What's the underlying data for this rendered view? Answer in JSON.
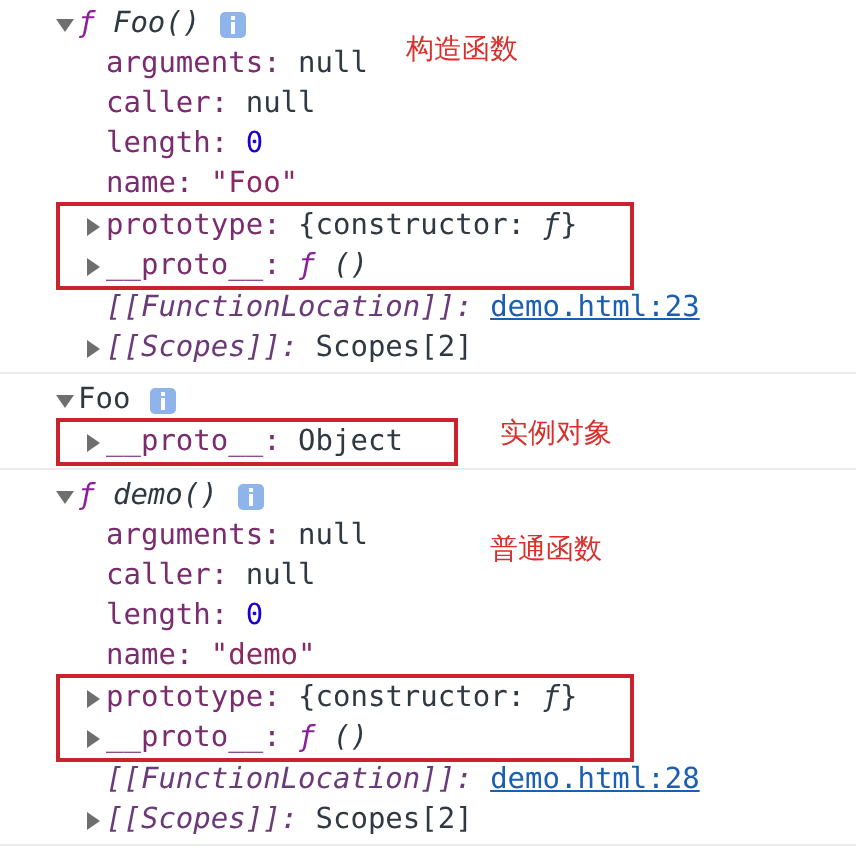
{
  "entries": [
    {
      "kind": "function",
      "prefix": "ƒ",
      "name": "Foo()",
      "expanded": true,
      "annotation": "构造函数",
      "properties": [
        {
          "key": "arguments:",
          "value": "null",
          "kind": "plain",
          "expandable": false,
          "internal": false,
          "highlighted": false
        },
        {
          "key": "caller:",
          "value": "null",
          "kind": "plain",
          "expandable": false,
          "internal": false,
          "highlighted": false
        },
        {
          "key": "length:",
          "value": "0",
          "kind": "number",
          "expandable": false,
          "internal": false,
          "highlighted": false
        },
        {
          "key": "name:",
          "value": "\"Foo\"",
          "kind": "string",
          "expandable": false,
          "internal": false,
          "highlighted": false
        },
        {
          "key": "prototype:",
          "value": "{constructor: *ƒ*}",
          "kind": "plain",
          "expandable": true,
          "internal": false,
          "highlighted": true
        },
        {
          "key": "__proto__:",
          "value": "ƒ ()",
          "kind": "function",
          "expandable": true,
          "internal": false,
          "highlighted": true
        },
        {
          "key": "[[FunctionLocation]]:",
          "value": "demo.html:23",
          "kind": "link",
          "expandable": false,
          "internal": true,
          "highlighted": false
        },
        {
          "key": "[[Scopes]]:",
          "value": "Scopes[2]",
          "kind": "plain",
          "expandable": true,
          "internal": true,
          "highlighted": false
        }
      ]
    },
    {
      "kind": "object",
      "name": "Foo",
      "expanded": true,
      "annotation": "实例对象",
      "properties": [
        {
          "key": "__proto__:",
          "value": "Object",
          "kind": "plain",
          "expandable": true,
          "internal": false,
          "highlighted": true
        }
      ]
    },
    {
      "kind": "function",
      "prefix": "ƒ",
      "name": "demo()",
      "expanded": true,
      "annotation": "普通函数",
      "properties": [
        {
          "key": "arguments:",
          "value": "null",
          "kind": "plain",
          "expandable": false,
          "internal": false,
          "highlighted": false
        },
        {
          "key": "caller:",
          "value": "null",
          "kind": "plain",
          "expandable": false,
          "internal": false,
          "highlighted": false
        },
        {
          "key": "length:",
          "value": "0",
          "kind": "number",
          "expandable": false,
          "internal": false,
          "highlighted": false
        },
        {
          "key": "name:",
          "value": "\"demo\"",
          "kind": "string",
          "expandable": false,
          "internal": false,
          "highlighted": false
        },
        {
          "key": "prototype:",
          "value": "{constructor: *ƒ*}",
          "kind": "plain",
          "expandable": true,
          "internal": false,
          "highlighted": true
        },
        {
          "key": "__proto__:",
          "value": "ƒ ()",
          "kind": "function",
          "expandable": true,
          "internal": false,
          "highlighted": true
        },
        {
          "key": "[[FunctionLocation]]:",
          "value": "demo.html:28",
          "kind": "link",
          "expandable": false,
          "internal": true,
          "highlighted": false
        },
        {
          "key": "[[Scopes]]:",
          "value": "Scopes[2]",
          "kind": "plain",
          "expandable": true,
          "internal": true,
          "highlighted": false
        }
      ]
    }
  ]
}
